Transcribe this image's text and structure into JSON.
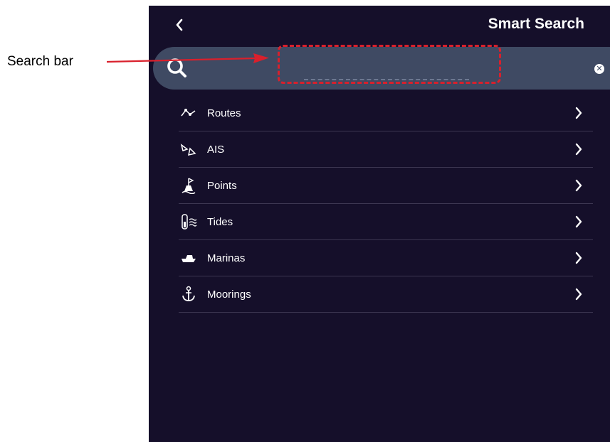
{
  "annotation": {
    "label": "Search bar"
  },
  "header": {
    "title": "Smart Search",
    "back_icon": "chevron-left-icon"
  },
  "search": {
    "value": "",
    "placeholder": "",
    "icon": "search-icon",
    "clear_icon": "clear-icon"
  },
  "menu": {
    "items": [
      {
        "label": "Routes",
        "icon": "route-icon"
      },
      {
        "label": "AIS",
        "icon": "ais-target-icon"
      },
      {
        "label": "Points",
        "icon": "buoy-icon"
      },
      {
        "label": "Tides",
        "icon": "tide-icon"
      },
      {
        "label": "Marinas",
        "icon": "boat-icon"
      },
      {
        "label": "Moorings",
        "icon": "anchor-icon"
      }
    ]
  },
  "colors": {
    "panel_background": "#150f2a",
    "search_bar": "#3f4a63",
    "divider": "#3d3752",
    "annotation_red": "#d9202c"
  }
}
